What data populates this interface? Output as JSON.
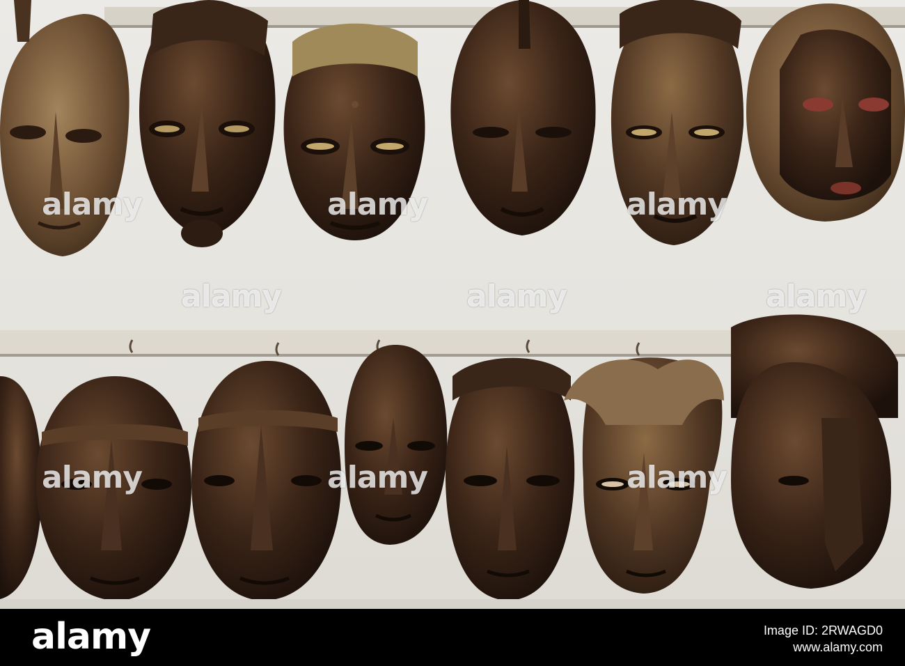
{
  "photo": {
    "subject": "wooden masks on wall rails",
    "colors": {
      "wall": "#e9e7e2",
      "rail": "#d9d6cc",
      "mask_dark": "#2a1a12",
      "mask_mid": "#4a3220",
      "mask_light": "#7a5a3c",
      "gold": "#b59a62"
    }
  },
  "watermarks": [
    "alamy",
    "alamy",
    "alamy",
    "alamy",
    "alamy",
    "alamy",
    "alamy",
    "alamy",
    "alamy"
  ],
  "footer": {
    "brand": "alamy",
    "image_id_label": "Image ID: 2RWAGD0",
    "site": "www.alamy.com"
  }
}
